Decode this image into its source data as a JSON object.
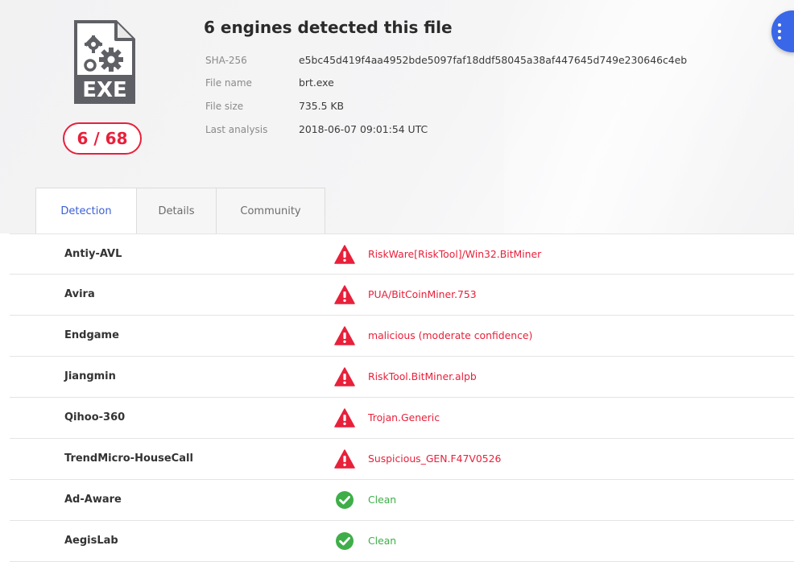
{
  "summary": {
    "title": "6 engines detected this file",
    "score": "6 / 68",
    "file_type": "EXE",
    "meta": [
      {
        "label": "SHA-256",
        "value": "e5bc45d419f4aa4952bde5097faf18ddf58045a38af447645d749e230646c4eb"
      },
      {
        "label": "File name",
        "value": "brt.exe"
      },
      {
        "label": "File size",
        "value": "735.5 KB"
      },
      {
        "label": "Last analysis",
        "value": "2018-06-07 09:01:54 UTC"
      }
    ]
  },
  "tabs": [
    {
      "label": "Detection",
      "active": true
    },
    {
      "label": "Details",
      "active": false
    },
    {
      "label": "Community",
      "active": false
    }
  ],
  "results": [
    {
      "engine": "Antiy-AVL",
      "status": "malicious",
      "icon": "warning-icon",
      "verdict": "RiskWare[RiskTool]/Win32.BitMiner"
    },
    {
      "engine": "Avira",
      "status": "malicious",
      "icon": "warning-icon",
      "verdict": "PUA/BitCoinMiner.753"
    },
    {
      "engine": "Endgame",
      "status": "malicious",
      "icon": "warning-icon",
      "verdict": "malicious (moderate confidence)"
    },
    {
      "engine": "Jiangmin",
      "status": "malicious",
      "icon": "warning-icon",
      "verdict": "RiskTool.BitMiner.alpb"
    },
    {
      "engine": "Qihoo-360",
      "status": "malicious",
      "icon": "warning-icon",
      "verdict": "Trojan.Generic"
    },
    {
      "engine": "TrendMicro-HouseCall",
      "status": "malicious",
      "icon": "warning-icon",
      "verdict": "Suspicious_GEN.F47V0526"
    },
    {
      "engine": "Ad-Aware",
      "status": "clean",
      "icon": "check-circle-icon",
      "verdict": "Clean"
    },
    {
      "engine": "AegisLab",
      "status": "clean",
      "icon": "check-circle-icon",
      "verdict": "Clean"
    }
  ],
  "colors": {
    "malicious": "#e8203a",
    "clean": "#3fae49",
    "accent": "#3b5fd6",
    "fab": "#3a67e8"
  }
}
